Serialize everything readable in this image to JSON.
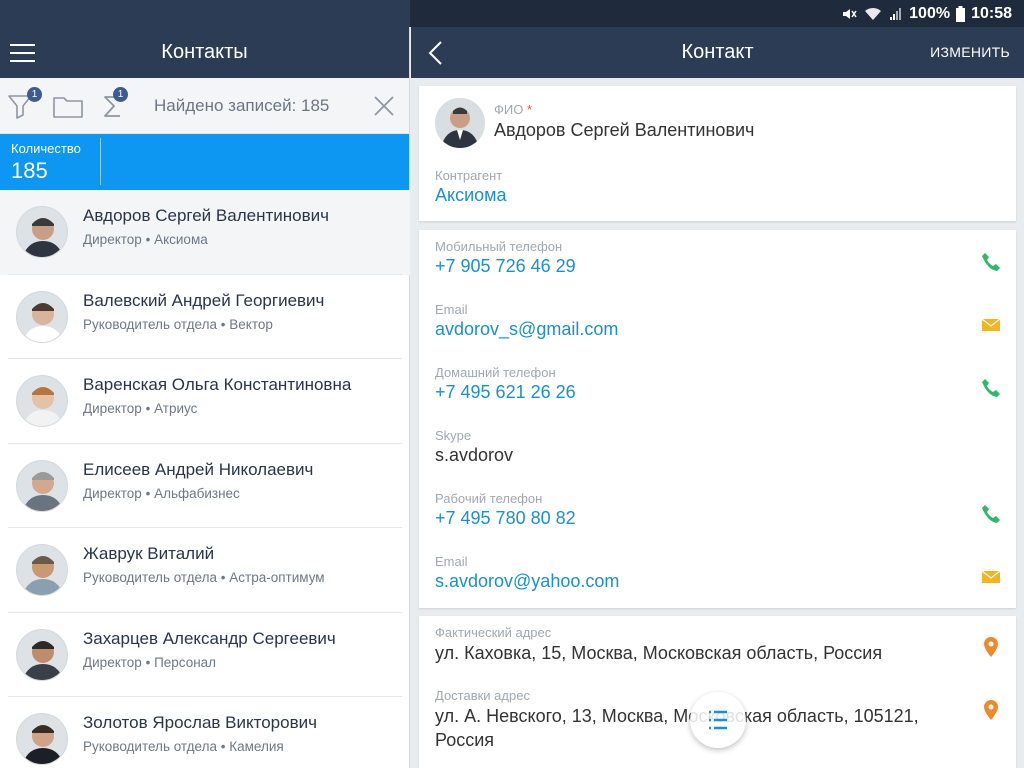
{
  "status_bar": {
    "battery": "100%",
    "time": "10:58"
  },
  "left": {
    "title": "Контакты",
    "filter_badge": "1",
    "sum_badge": "1",
    "found_text": "Найдено записей: 185",
    "count_label": "Количество",
    "count_value": "185",
    "contacts": [
      {
        "name": "Авдоров Сергей Валентинович",
        "role": "Директор",
        "company": "Аксиома"
      },
      {
        "name": "Валевский Андрей Георгиевич",
        "role": "Руководитель отдела",
        "company": "Вектор"
      },
      {
        "name": "Варенская Ольга Константиновна",
        "role": "Директор",
        "company": "Атриус"
      },
      {
        "name": "Елисеев Андрей Николаевич",
        "role": "Директор",
        "company": "Альфабизнес"
      },
      {
        "name": "Жаврук Виталий",
        "role": "Руководитель отдела",
        "company": "Астра-оптимум"
      },
      {
        "name": "Захарцев Александр Сергеевич",
        "role": "Директор",
        "company": "Персонал"
      },
      {
        "name": "Золотов Ярослав Викторович",
        "role": "Руководитель отдела",
        "company": "Камелия"
      }
    ],
    "separator": "•"
  },
  "right": {
    "title": "Контакт",
    "edit_label": "ИЗМЕНИТЬ",
    "fio_label": "ФИО",
    "required_mark": "*",
    "fio_value": "Авдоров Сергей Валентинович",
    "counterparty_label": "Контрагент",
    "counterparty_value": "Аксиома",
    "mobile_label": "Мобильный телефон",
    "mobile_value": "+7 905 726 46 29",
    "email1_label": "Email",
    "email1_value": "avdorov_s@gmail.com",
    "home_label": "Домашний телефон",
    "home_value": "+7 495 621 26 26",
    "skype_label": "Skype",
    "skype_value": "s.avdorov",
    "work_label": "Рабочий телефон",
    "work_value": "+7 495 780 80 82",
    "email2_label": "Email",
    "email2_value": "s.avdorov@yahoo.com",
    "actual_address_label": "Фактический адрес",
    "actual_address_value": "ул. Каховка, 15, Москва, Московская область, Россия",
    "delivery_address_label": "Доставки адрес",
    "delivery_address_line1": "ул. А. Невского, 13, Москва, Московская область, 105121,",
    "delivery_address_line2": "Россия"
  },
  "colors": {
    "header": "#2d3c55",
    "accent_blue": "#0d97f3",
    "link": "#1a8fd5",
    "phone_icon": "#2fb86a",
    "mail_icon": "#f2b51d",
    "pin_icon": "#ef8a2a"
  }
}
